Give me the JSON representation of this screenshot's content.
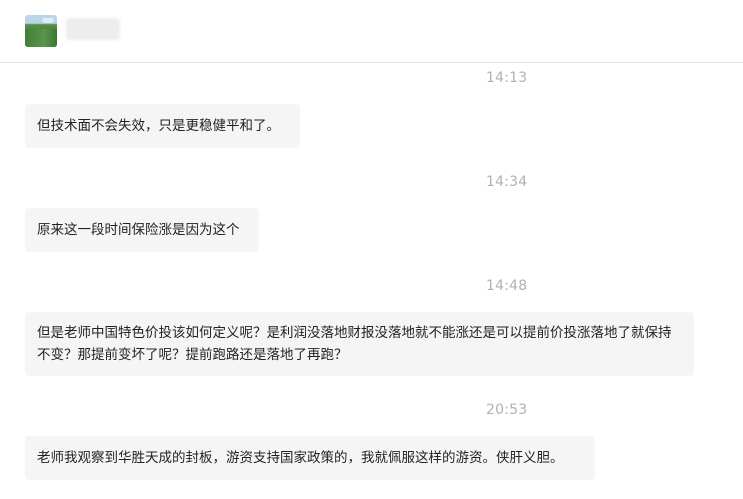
{
  "header": {
    "contact_name": "■■■■"
  },
  "messages": [
    {
      "time": "14:13",
      "text": "但技术面不会失效，只是更稳健平和了。"
    },
    {
      "time": "14:34",
      "text": "原来这一段时间保险涨是因为这个"
    },
    {
      "time": "14:48",
      "text": "但是老师中国特色价投该如何定义呢？是利润没落地财报没落地就不能涨还是可以提前价投涨落地了就保持不变？那提前变坏了呢？提前跑路还是落地了再跑？"
    },
    {
      "time": "20:53",
      "text": "老师我观察到华胜天成的封板，游资支持国家政策的，我就佩服这样的游资。侠肝义胆。"
    }
  ]
}
